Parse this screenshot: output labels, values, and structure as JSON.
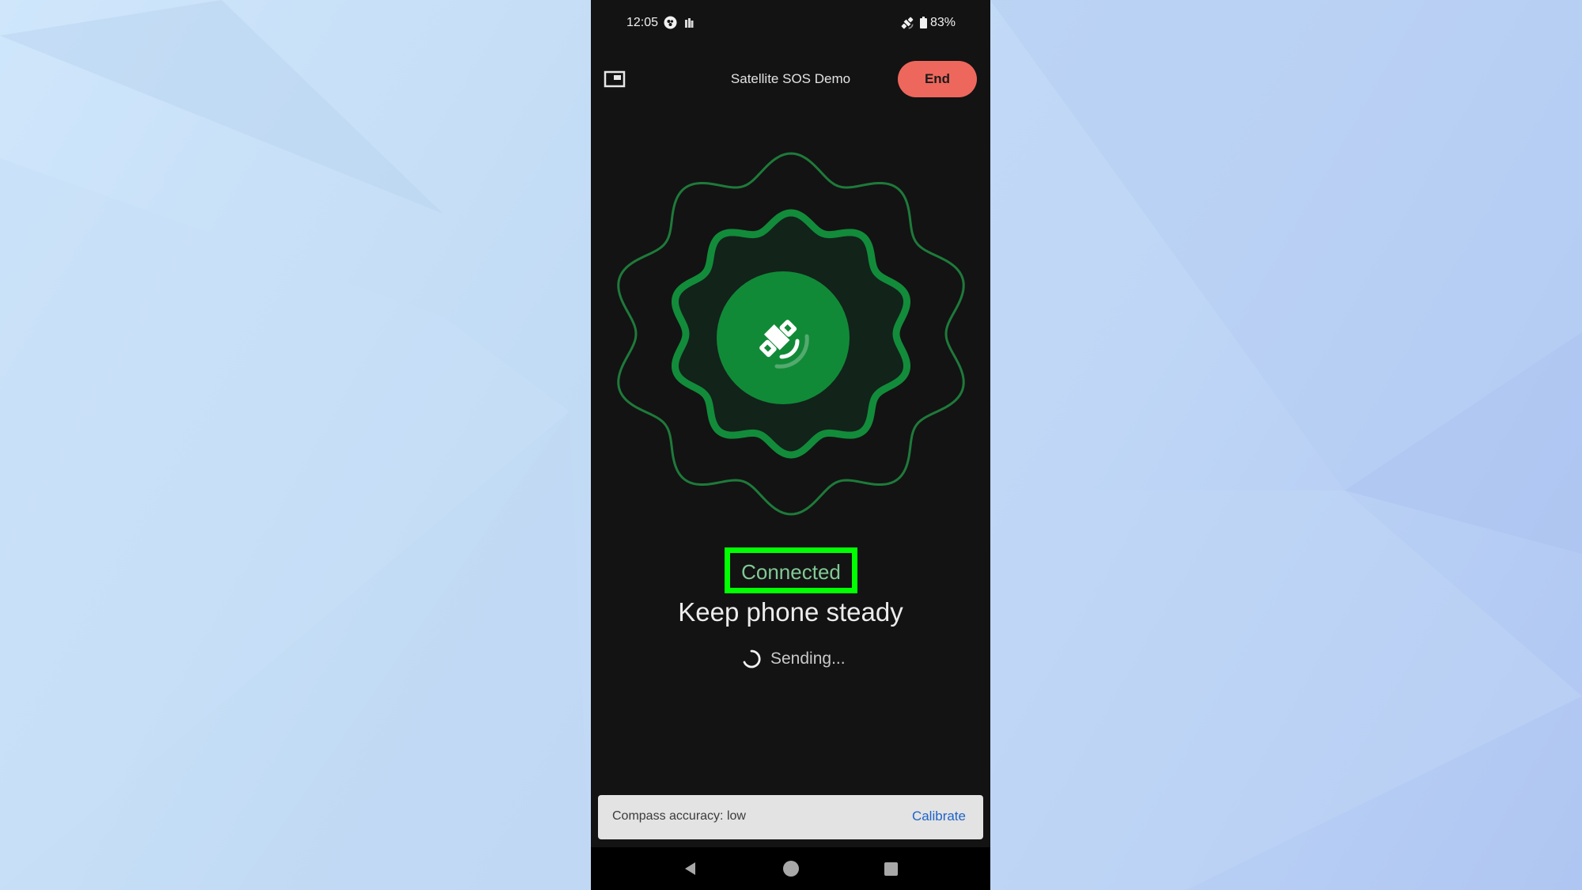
{
  "status_bar": {
    "time": "12:05",
    "left_icons": [
      "vpn-key-icon",
      "notification-icon"
    ],
    "right_icons": [
      "satellite-icon",
      "battery-icon"
    ],
    "battery_percent": "83%"
  },
  "header": {
    "pip_icon": "picture-in-picture-icon",
    "title": "Satellite SOS Demo",
    "end_label": "End"
  },
  "graphic": {
    "center_icon": "satellite-icon",
    "colors": {
      "outer_ring": "#1e7a3a",
      "inner_ring": "#128c3a",
      "inner_fill": "#12231a",
      "center_fill": "#118a37",
      "icon": "#ffffff"
    }
  },
  "status": {
    "connection": "Connected",
    "headline": "Keep phone steady",
    "progress_text": "Sending...",
    "highlight_color": "#00ff00",
    "connection_color": "#81c995"
  },
  "snackbar": {
    "message": "Compass accuracy: low",
    "action_label": "Calibrate"
  },
  "nav_bar": {
    "buttons": [
      "back",
      "home",
      "recents"
    ]
  },
  "colors": {
    "end_button": "#ee675c",
    "link": "#1f63c9",
    "screen_bg": "#131313"
  }
}
